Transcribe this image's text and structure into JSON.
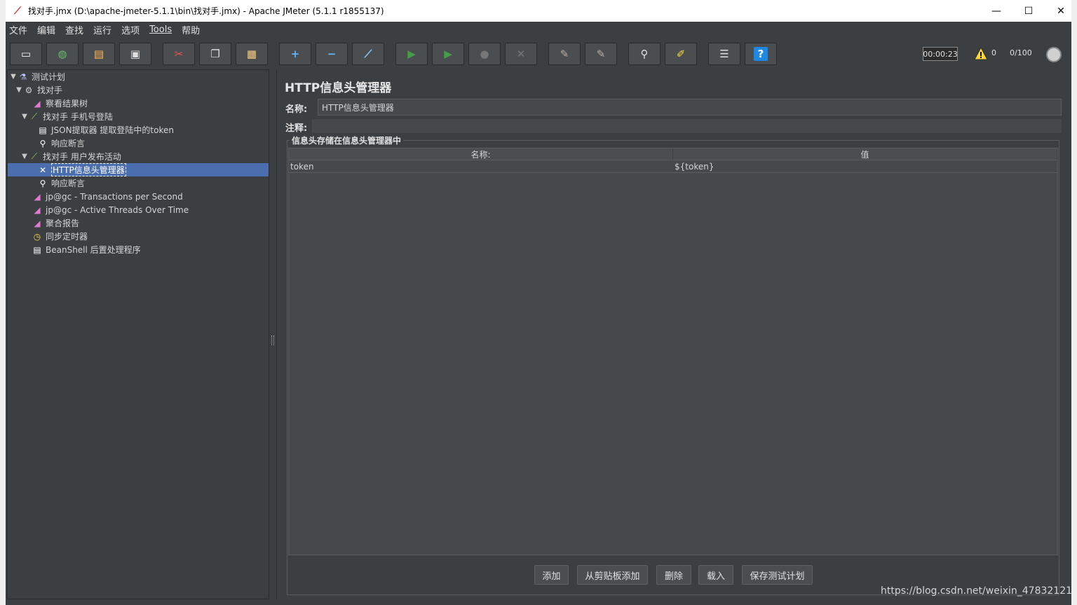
{
  "window": {
    "title": "找对手.jmx (D:\\apache-jmeter-5.1.1\\bin\\找对手.jmx) - Apache JMeter (5.1.1 r1855137)",
    "minimize": "—",
    "maximize": "☐",
    "close": "✕"
  },
  "menu": [
    "文件",
    "编辑",
    "查找",
    "运行",
    "选项",
    "Tools",
    "帮助"
  ],
  "toolbar": {
    "buttons": [
      {
        "name": "new-icon",
        "glyph": "▭"
      },
      {
        "name": "templates-icon",
        "glyph": "◍"
      },
      {
        "name": "open-icon",
        "glyph": "▤"
      },
      {
        "name": "save-icon",
        "glyph": "▣"
      },
      {
        "name": "cut-icon",
        "glyph": "✂"
      },
      {
        "name": "copy-icon",
        "glyph": "❐"
      },
      {
        "name": "paste-icon",
        "glyph": "▦"
      },
      {
        "name": "expand-icon",
        "glyph": "+"
      },
      {
        "name": "collapse-icon",
        "glyph": "−"
      },
      {
        "name": "toggle-icon",
        "glyph": "⟋"
      },
      {
        "name": "start-icon",
        "glyph": "▶"
      },
      {
        "name": "start-no-pause-icon",
        "glyph": "▶"
      },
      {
        "name": "stop-icon",
        "glyph": "●"
      },
      {
        "name": "shutdown-icon",
        "glyph": "✕"
      },
      {
        "name": "clear-icon",
        "glyph": "✎"
      },
      {
        "name": "clear-all-icon",
        "glyph": "✎"
      },
      {
        "name": "search-icon",
        "glyph": "⚲"
      },
      {
        "name": "reset-search-icon",
        "glyph": "✐"
      },
      {
        "name": "function-helper-icon",
        "glyph": "☰"
      },
      {
        "name": "help-icon",
        "glyph": "?"
      }
    ],
    "timer": "00:00:23",
    "warnings": "0",
    "threads": "0/100"
  },
  "tree": [
    {
      "label": "测试计划",
      "icon": "test-plan-icon",
      "toggle": "▼",
      "color": "#c0c0ff"
    },
    {
      "label": "找对手",
      "icon": "thread-group-icon",
      "toggle": "▼",
      "color": "#cccccc"
    },
    {
      "label": "察看结果树",
      "icon": "listener-icon",
      "toggle": "",
      "color": "#e07ad0"
    },
    {
      "label": "找对手 手机号登陆",
      "icon": "sampler-icon",
      "toggle": "▼",
      "color": "#9ccc65"
    },
    {
      "label": "JSON提取器  提取登陆中的token",
      "icon": "extractor-icon",
      "toggle": "",
      "color": "#ffffff"
    },
    {
      "label": "响应断言",
      "icon": "assertion-icon",
      "toggle": "",
      "color": "#ffffff"
    },
    {
      "label": "找对手 用户发布活动",
      "icon": "sampler-icon",
      "toggle": "▼",
      "color": "#9ccc65"
    },
    {
      "label": "HTTP信息头管理器",
      "icon": "header-manager-icon",
      "toggle": "",
      "color": "#ffffff"
    },
    {
      "label": "响应断言",
      "icon": "assertion-icon",
      "toggle": "",
      "color": "#ffffff"
    },
    {
      "label": "jp@gc - Transactions per Second",
      "icon": "listener-icon",
      "toggle": "",
      "color": "#e07ad0"
    },
    {
      "label": "jp@gc - Active Threads Over Time",
      "icon": "listener-icon",
      "toggle": "",
      "color": "#e07ad0"
    },
    {
      "label": "聚合报告",
      "icon": "listener-icon",
      "toggle": "",
      "color": "#e07ad0"
    },
    {
      "label": "同步定时器",
      "icon": "timer-icon",
      "toggle": "",
      "color": "#ffd54f"
    },
    {
      "label": "BeanShell 后置处理程序",
      "icon": "postprocessor-icon",
      "toggle": "",
      "color": "#ffffff"
    }
  ],
  "panel": {
    "title": "HTTP信息头管理器",
    "name_label": "名称:",
    "name_value": "HTTP信息头管理器",
    "comment_label": "注释:",
    "group_title": "信息头存储在信息头管理器中",
    "columns": [
      "名称:",
      "值"
    ],
    "rows": [
      [
        "token",
        "${token}"
      ]
    ],
    "buttons": [
      "添加",
      "从剪贴板添加",
      "删除",
      "载入",
      "保存测试计划"
    ]
  },
  "watermark": "https://blog.csdn.net/weixin_47832121",
  "colors": {
    "background": "#3c3f41",
    "selection": "#4b6eaf",
    "field": "#45494a"
  }
}
